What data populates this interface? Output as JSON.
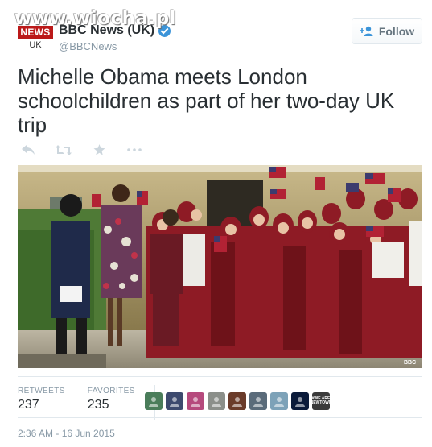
{
  "watermark": "www.wiocha.pl",
  "account": {
    "logo_text": "NEWS",
    "logo_sub": "UK",
    "name": "BBC News (UK)",
    "handle": "@BBCNews",
    "verified": true
  },
  "follow_label": "Follow",
  "tweet_text": "Michelle Obama meets London schoolchildren as part of her two-day UK trip",
  "actions": [
    "reply-icon",
    "retweet-icon",
    "favorite-icon",
    "more-icon"
  ],
  "photo": {
    "description_icon": "photo",
    "watermark": "BBC"
  },
  "stats": {
    "retweets_label": "RETWEETS",
    "retweets": "237",
    "favorites_label": "FAVORITES",
    "favorites": "235"
  },
  "favoriters": [
    {
      "color": "#4a7d5a",
      "icon": "avatar-icon"
    },
    {
      "color": "#3d4a6e",
      "icon": "avatar-icon"
    },
    {
      "color": "#b64a7d",
      "icon": "avatar-icon"
    },
    {
      "color": "#8b8f8a",
      "icon": "avatar-icon"
    },
    {
      "color": "#6a3b2a",
      "icon": "avatar-icon"
    },
    {
      "color": "#5a6b7a",
      "icon": "avatar-icon"
    },
    {
      "color": "#7da2b8",
      "icon": "avatar-icon"
    },
    {
      "color": "#0b1b3a",
      "icon": "avatar-icon"
    },
    {
      "color": "#3a3a3a",
      "icon": "avatar-icon",
      "text": "#WE ARE NEWTOWN"
    }
  ],
  "timestamp": "2:36 AM - 16 Jun 2015",
  "colors": {
    "brand": "#bb1919",
    "verified": "#3b94d9",
    "muted": "#8899a6"
  }
}
